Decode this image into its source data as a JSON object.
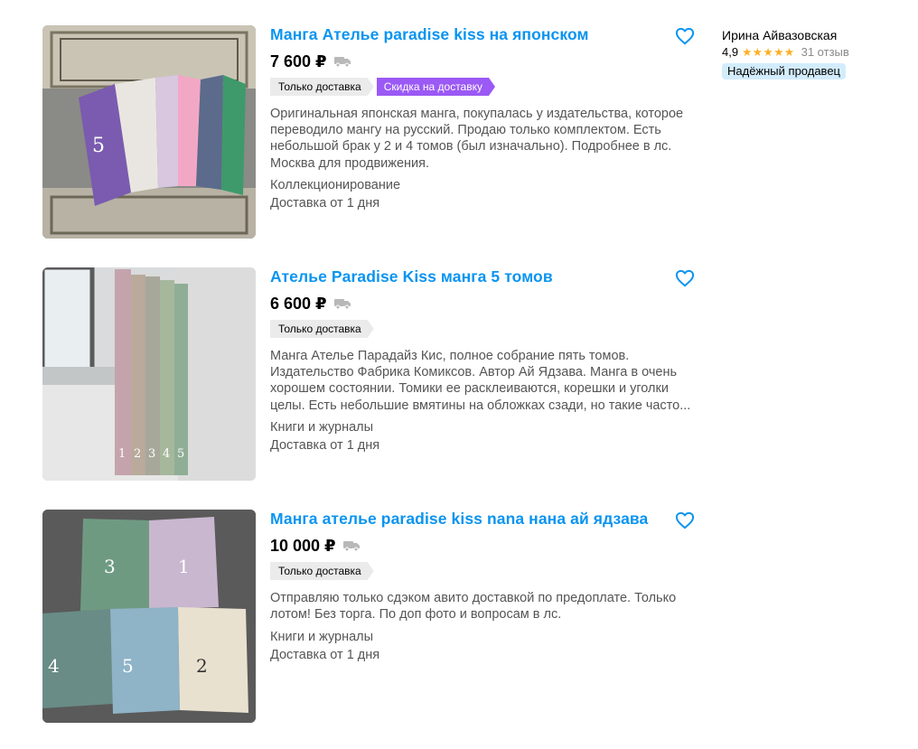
{
  "colors": {
    "link": "#0a94f0",
    "price": "#000000",
    "tag_gray": "#ebebeb",
    "tag_purple": "#9b59f5",
    "stars": "#ffb021",
    "badge": "#d3ecfc"
  },
  "listings": [
    {
      "title": "Манга Ателье paradise kiss на японском",
      "price": "7 600 ₽",
      "tags": [
        "Только доставка",
        "Скидка на доставку"
      ],
      "description": "Оригинальная японская манга, покупалась у издательства, которое переводило мангу на русский. Продаю только комплектом. Есть небольшой брак у 2 и 4 томов (был изначально). Подробнее в лс. Москва для продвижения.",
      "category": "Коллекционирование",
      "delivery": "Доставка от 1 дня",
      "seller": {
        "name": "Ирина Айвазовская",
        "rating": "4,9",
        "stars": "★★★★★",
        "reviews": "31 отзыв",
        "badge": "Надёжный продавец"
      }
    },
    {
      "title": "Ателье Paradise Kiss манга 5 томов",
      "price": "6 600 ₽",
      "tags": [
        "Только доставка"
      ],
      "description": "Манга Ателье Парадайз Кис, полное собрание пять томов. Издательство Фабрика Комиксов. Автор Ай Ядзава. Манга в очень хорошем состоянии. Томики ее расклеиваются, корешки и уголки целы. Есть небольшие вмятины на обложках сзади, но такие часто...",
      "category": "Книги и журналы",
      "delivery": "Доставка от 1 дня"
    },
    {
      "title": "Манга ателье paradise kiss nana нана ай ядзава",
      "price": "10 000 ₽",
      "tags": [
        "Только доставка"
      ],
      "description": "Отправляю только сдэком авито доставкой по предоплате. Только лотом! Без торга. По доп фото и вопросам в лс.",
      "category": "Книги и журналы",
      "delivery": "Доставка от 1 дня"
    }
  ]
}
